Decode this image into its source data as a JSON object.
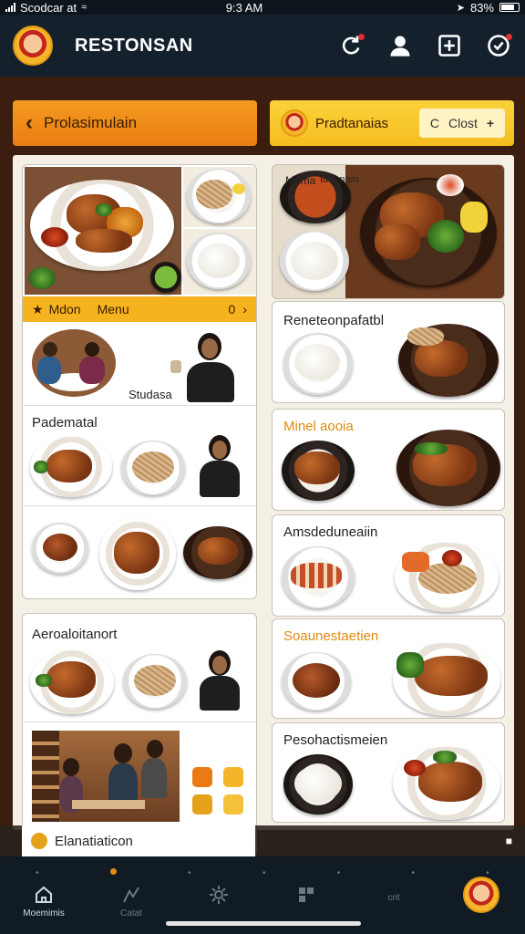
{
  "status_bar": {
    "carrier": "Scodcar at",
    "time": "9:3 AM",
    "battery": "83%"
  },
  "header": {
    "title": "RESTONSAN",
    "icons": [
      "sync-icon",
      "profile-icon",
      "add-box-icon",
      "settings-icon"
    ]
  },
  "left_pill": {
    "label": "Prolasimulain"
  },
  "right_pill": {
    "label": "Pradtanaias",
    "button_label": "Clost",
    "button_prefix": "C",
    "button_suffix": "+"
  },
  "left_column": {
    "menu_strip": {
      "label_a": "Mdon",
      "label_b": "Menu",
      "count": "0"
    },
    "dining_card": {
      "caption": "Studasa"
    },
    "card_2": {
      "title": "Padematal"
    },
    "card_4": {
      "title": "Aeroaloitanort"
    }
  },
  "right_column": {
    "card_1": {
      "photo_text_a": "Mema",
      "photo_text_b": "Idonnam"
    },
    "card_2": {
      "title": "Reneteonpafatbl"
    },
    "card_3": {
      "title": "Minel aooia"
    },
    "card_4": {
      "title": "Amsdeduneaiin"
    },
    "card_5": {
      "title": "Soaunestaetien"
    },
    "card_6": {
      "title": "Pesohactismeien"
    }
  },
  "overlay_banner": {
    "label": "Elanatiaticon"
  },
  "tab_bar": {
    "tabs": [
      {
        "label": "Moemimis",
        "icon": "home-icon"
      },
      {
        "label": "Catat",
        "icon": "chart-icon"
      },
      {
        "label": "",
        "icon": "gear-icon"
      },
      {
        "label": "",
        "icon": "grid-icon"
      },
      {
        "label": "crit",
        "icon": "none"
      },
      {
        "label": "",
        "icon": "avatar-icon"
      }
    ]
  },
  "colors": {
    "header_bg": "#14212c",
    "accent_orange": "#ea7d12",
    "accent_yellow": "#f4bd20",
    "page_bg": "#3b1e0f"
  }
}
